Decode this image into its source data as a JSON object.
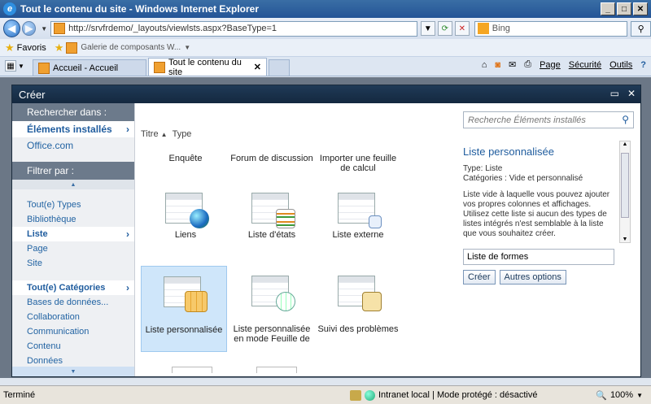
{
  "window": {
    "title": "Tout le contenu du site - Windows Internet Explorer"
  },
  "address": {
    "url": "http://srvfrdemo/_layouts/viewlsts.aspx?BaseType=1"
  },
  "search": {
    "placeholder": "Bing"
  },
  "favorites": {
    "label": "Favoris",
    "item": "Galerie de composants W..."
  },
  "tabs": [
    {
      "label": "Accueil - Accueil"
    },
    {
      "label": "Tout le contenu du site"
    }
  ],
  "toolbar": {
    "page": "Page",
    "security": "Sécurité",
    "tools": "Outils"
  },
  "dialog": {
    "title": "Créer",
    "nav": {
      "search_in": "Rechercher dans :",
      "installed": "Éléments installés",
      "office": "Office.com",
      "filter_by": "Filtrer par :",
      "types": [
        "Tout(e) Types",
        "Bibliothèque",
        "Liste",
        "Page",
        "Site"
      ],
      "categories_head": "Tout(e) Catégories",
      "categories": [
        "Bases de données...",
        "Collaboration",
        "Communication",
        "Contenu",
        "Données"
      ]
    },
    "sort": {
      "title": "Titre",
      "type": "Type"
    },
    "tiles": [
      {
        "label": "Enquête"
      },
      {
        "label": "Forum de discussion"
      },
      {
        "label": "Importer une feuille de calcul"
      },
      {
        "label": "Liens"
      },
      {
        "label": "Liste d'états"
      },
      {
        "label": "Liste externe"
      },
      {
        "label": "Liste personnalisée"
      },
      {
        "label": "Liste personnalisée en mode Feuille de"
      },
      {
        "label": "Suivi des problèmes"
      }
    ],
    "detail": {
      "search_placeholder": "Recherche Éléments installés",
      "title": "Liste personnalisée",
      "type": "Type: Liste",
      "categories": "Catégories : Vide et personnalisé",
      "description": "Liste vide à laquelle vous pouvez ajouter vos propres colonnes et affichages. Utilisez cette liste si aucun des types de listes intégrés n'est semblable à la liste que vous souhaitez créer.",
      "name_value": "Liste de formes",
      "create": "Créer",
      "more": "Autres options"
    }
  },
  "status": {
    "left": "Terminé",
    "zone": "Intranet local | Mode protégé : désactivé",
    "zoom": "100%"
  }
}
